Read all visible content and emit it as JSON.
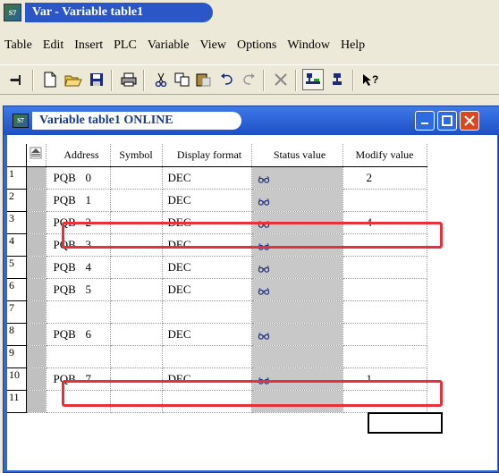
{
  "app": {
    "title": "Var - Variable table1",
    "icon_label": "S7"
  },
  "menu": [
    "Table",
    "Edit",
    "Insert",
    "PLC",
    "Variable",
    "View",
    "Options",
    "Window",
    "Help"
  ],
  "toolbar": {
    "buttons": [
      "pin-icon",
      "new-icon",
      "open-icon",
      "save-icon",
      "print-icon",
      "cut-icon",
      "copy-icon",
      "paste-icon",
      "undo-icon",
      "redo-icon",
      "delete-icon",
      "monitor-icon",
      "network-icon",
      "help-icon"
    ]
  },
  "child_window": {
    "title": "Variable table1  ONLINE",
    "icon_label": "S7"
  },
  "columns": [
    "Address",
    "Symbol",
    "Display format",
    "Status value",
    "Modify value"
  ],
  "rows": [
    {
      "num": "1",
      "addr_a": "PQB",
      "addr_b": "0",
      "symbol": "",
      "format": "DEC",
      "status": "glasses",
      "modify": "2"
    },
    {
      "num": "2",
      "addr_a": "PQB",
      "addr_b": "1",
      "symbol": "",
      "format": "DEC",
      "status": "glasses",
      "modify": ""
    },
    {
      "num": "3",
      "addr_a": "PQB",
      "addr_b": "2",
      "symbol": "",
      "format": "DEC",
      "status": "glasses",
      "modify": "4"
    },
    {
      "num": "4",
      "addr_a": "PQB",
      "addr_b": "3",
      "symbol": "",
      "format": "DEC",
      "status": "glasses",
      "modify": ""
    },
    {
      "num": "5",
      "addr_a": "PQB",
      "addr_b": "4",
      "symbol": "",
      "format": "DEC",
      "status": "glasses",
      "modify": ""
    },
    {
      "num": "6",
      "addr_a": "PQB",
      "addr_b": "5",
      "symbol": "",
      "format": "DEC",
      "status": "glasses",
      "modify": ""
    },
    {
      "num": "7",
      "addr_a": "",
      "addr_b": "",
      "symbol": "",
      "format": "",
      "status": "",
      "modify": ""
    },
    {
      "num": "8",
      "addr_a": "PQB",
      "addr_b": "6",
      "symbol": "",
      "format": "DEC",
      "status": "glasses",
      "modify": ""
    },
    {
      "num": "9",
      "addr_a": "",
      "addr_b": "",
      "symbol": "",
      "format": "",
      "status": "",
      "modify": ""
    },
    {
      "num": "10",
      "addr_a": "PQB",
      "addr_b": "7",
      "symbol": "",
      "format": "DEC",
      "status": "glasses",
      "modify": "1"
    },
    {
      "num": "11",
      "addr_a": "",
      "addr_b": "",
      "symbol": "",
      "format": "",
      "status": "",
      "modify": ""
    }
  ],
  "colors": {
    "highlight": "#e8303a",
    "title_blue": "#2a56c8"
  }
}
